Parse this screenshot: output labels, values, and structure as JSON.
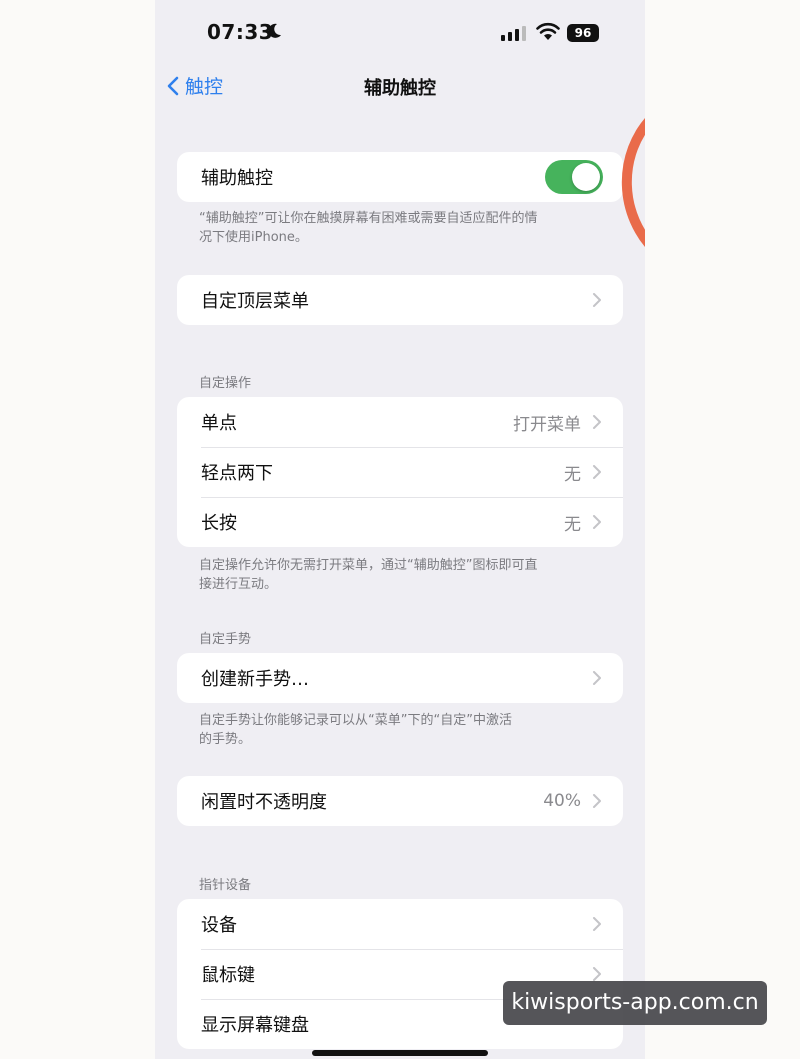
{
  "status_bar": {
    "time": "07:33",
    "battery": "96"
  },
  "nav": {
    "back_label": "触控",
    "title": "辅助触控"
  },
  "assistive_touch": {
    "label": "辅助触控",
    "enabled": true,
    "caption_line1": "“辅助触控”可让你在触摸屏幕有困难或需要自适应配件的情",
    "caption_line2": "况下使用iPhone。"
  },
  "top_menu": {
    "label": "自定顶层菜单"
  },
  "custom_actions": {
    "header": "自定操作",
    "rows": [
      {
        "label": "单点",
        "value": "打开菜单"
      },
      {
        "label": "轻点两下",
        "value": "无"
      },
      {
        "label": "长按",
        "value": "无"
      }
    ],
    "caption_line1": "自定操作允许你无需打开菜单，通过“辅助触控”图标即可直",
    "caption_line2": "接进行互动。"
  },
  "custom_gestures": {
    "header": "自定手势",
    "create_label": "创建新手势…",
    "caption_line1": "自定手势让你能够记录可以从“菜单”下的“自定”中激活",
    "caption_line2": "的手势。"
  },
  "idle_opacity": {
    "label": "闲置时不透明度",
    "value": "40%"
  },
  "pointer_devices": {
    "header": "指针设备",
    "rows": [
      {
        "label": "设备"
      },
      {
        "label": "鼠标键"
      },
      {
        "label": "显示屏幕键盘"
      }
    ]
  },
  "watermark": "kiwisports-app.com.cn",
  "colors": {
    "toggle_on": "#46b35c",
    "link_blue": "#2f80ed",
    "annotation_red": "#e8603c"
  }
}
